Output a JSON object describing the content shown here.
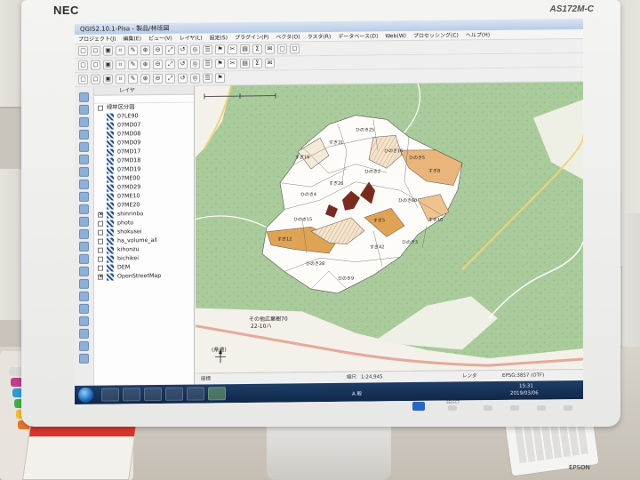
{
  "monitor": {
    "brand": "NEC",
    "model": "AS172M-C",
    "controls": [
      "SELECT",
      "",
      "",
      "",
      ""
    ]
  },
  "app": {
    "title": "QGIS2.10.1-Pisa - 製品/林班図",
    "menus": [
      "プロジェクト(J)",
      "編集(E)",
      "ビュー(V)",
      "レイヤ(L)",
      "設定(S)",
      "プラグイン(P)",
      "ベクタ(O)",
      "ラスタ(R)",
      "データベース(D)",
      "Web(W)",
      "プロセッシング(C)",
      "ヘルプ(H)"
    ]
  },
  "layers_panel": {
    "title": "レイヤ",
    "group_label": "緑林区分図",
    "sublayers": [
      "07LE90",
      "07MD07",
      "07MD08",
      "07MD09",
      "07MD17",
      "07MD18",
      "07MD19",
      "07ME00",
      "07MD29",
      "07ME10",
      "07ME20"
    ],
    "other_layers": [
      {
        "name": "shinrinbo",
        "checked": true
      },
      {
        "name": "photo",
        "checked": false
      },
      {
        "name": "shokusei",
        "checked": false
      },
      {
        "name": "ha_volume_all",
        "checked": false
      },
      {
        "name": "kihonzu",
        "checked": false
      },
      {
        "name": "bichikei",
        "checked": false
      },
      {
        "name": "DEM",
        "checked": false
      },
      {
        "name": "OpenStreetMap",
        "checked": true
      }
    ]
  },
  "map": {
    "stand_labels": [
      "すぎ16",
      "すぎ31",
      "ひのき25",
      "ひのき16",
      "ひのき5",
      "すぎ8",
      "ひのき4",
      "すぎ26",
      "ひのき2",
      "ひのき60",
      "すぎ12",
      "ひのき28",
      "ひのき9",
      "すぎ42",
      "ひのき3",
      "すぎ10",
      "ひのき15",
      "すぎ5"
    ],
    "place_labels": [
      "その他広葉樹70",
      "22-10ハ",
      "(県道)"
    ]
  },
  "statusbar": {
    "coord_label": "座標",
    "scale_label": "縮尺",
    "scale_value": "1:24,945",
    "crs": "EPSG:3857 (OTF)",
    "render_label": "レンダ"
  },
  "taskbar": {
    "time": "15:31",
    "date": "2019/03/06",
    "ime": "A 般"
  },
  "colors": {
    "map_base": "#aacb9b",
    "stand_orange": "#e0a354",
    "stand_brown": "#7a2b1f",
    "taskbar": "#1e3d66",
    "accent_blue": "#2a66c8"
  }
}
